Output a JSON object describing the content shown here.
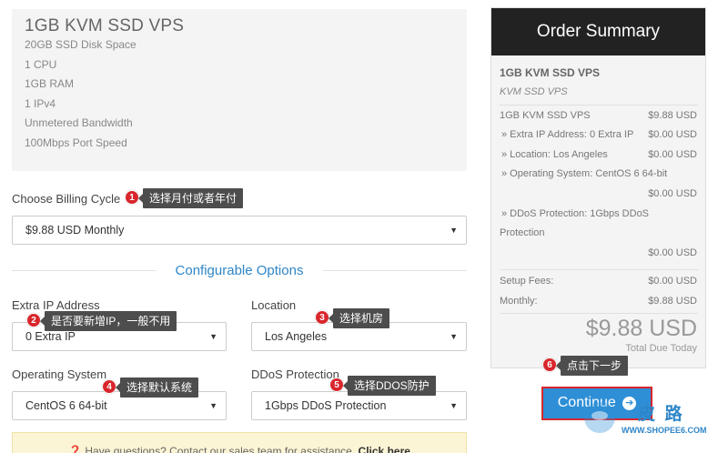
{
  "product": {
    "title": "1GB KVM SSD VPS",
    "features": [
      "20GB SSD Disk Space",
      "1 CPU",
      "1GB RAM",
      "1 IPv4",
      "Unmetered Bandwidth",
      "100Mbps Port Speed"
    ]
  },
  "billing": {
    "label": "Choose Billing Cycle",
    "value": "$9.88 USD Monthly"
  },
  "config": {
    "title": "Configurable Options",
    "extra_ip": {
      "label": "Extra IP Address",
      "value": "0 Extra IP"
    },
    "location": {
      "label": "Location",
      "value": "Los Angeles"
    },
    "os": {
      "label": "Operating System",
      "value": "CentOS 6 64-bit"
    },
    "ddos": {
      "label": "DDoS Protection",
      "value": "1Gbps DDoS Protection"
    }
  },
  "callouts": [
    {
      "num": "1",
      "text": "选择月付或者年付"
    },
    {
      "num": "2",
      "text": "是否要新增IP，一般不用"
    },
    {
      "num": "3",
      "text": "选择机房"
    },
    {
      "num": "4",
      "text": "选择默认系统"
    },
    {
      "num": "5",
      "text": "选择DDOS防护"
    },
    {
      "num": "6",
      "text": "点击下一步"
    }
  ],
  "help": {
    "icon": "question-circle-icon",
    "text": "Have questions? Contact our sales team for assistance.",
    "link": "Click here"
  },
  "summary": {
    "title": "Order Summary",
    "product_name": "1GB KVM SSD VPS",
    "product_group": "KVM SSD VPS",
    "lines": [
      {
        "text": "1GB KVM SSD VPS",
        "amount": "$9.88 USD"
      },
      {
        "text": "» Extra IP Address: 0 Extra IP",
        "amount": "$0.00 USD"
      },
      {
        "text": "» Location: Los Angeles",
        "amount": "$0.00 USD"
      },
      {
        "text": "» Operating System: CentOS 6 64-bit",
        "amount": "$0.00 USD"
      },
      {
        "text": "» DDoS Protection: 1Gbps DDoS",
        "text2": "Protection",
        "amount": "$0.00 USD"
      }
    ],
    "setup_label": "Setup Fees:",
    "setup_amount": "$0.00 USD",
    "monthly_label": "Monthly:",
    "monthly_amount": "$9.88 USD",
    "total": "$9.88 USD",
    "total_label": "Total Due Today"
  },
  "continue_label": "Continue",
  "continue_icon": "arrow-right-circle-icon",
  "watermark": {
    "text": "皮 路",
    "url": "WWW.SHOPEE6.COM"
  },
  "colors": {
    "accent": "#2e86c9",
    "callout": "#d8262c",
    "tip_bg": "#4d4d4d",
    "header_bg": "#222222"
  }
}
